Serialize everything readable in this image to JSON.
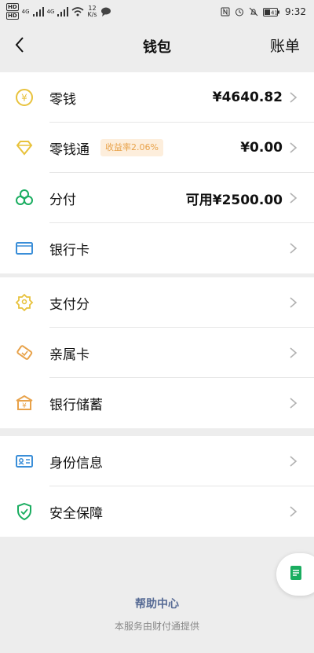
{
  "status_bar": {
    "hd1": "HD",
    "hd2": "HD",
    "net1": "4G",
    "net2": "4G",
    "speed_value": "12",
    "speed_unit": "K/s",
    "battery": "41",
    "time": "9:32"
  },
  "nav": {
    "title": "钱包",
    "right_label": "账单"
  },
  "section1": {
    "rows": [
      {
        "label": "零钱",
        "value": "¥4640.82"
      },
      {
        "label": "零钱通",
        "badge": "收益率2.06%",
        "value": "¥0.00"
      },
      {
        "label": "分付",
        "value": "可用¥2500.00"
      },
      {
        "label": "银行卡",
        "value": ""
      }
    ]
  },
  "section2": {
    "rows": [
      {
        "label": "支付分"
      },
      {
        "label": "亲属卡"
      },
      {
        "label": "银行储蓄"
      }
    ]
  },
  "section3": {
    "rows": [
      {
        "label": "身份信息"
      },
      {
        "label": "安全保障"
      }
    ]
  },
  "footer": {
    "help_link": "帮助中心",
    "note": "本服务由财付通提供"
  },
  "colors": {
    "accent_yellow": "#e8c23c",
    "accent_green": "#1aad60",
    "accent_blue": "#3a8ed8",
    "link_blue": "#576b95",
    "icon_orange": "#e8a24a"
  }
}
